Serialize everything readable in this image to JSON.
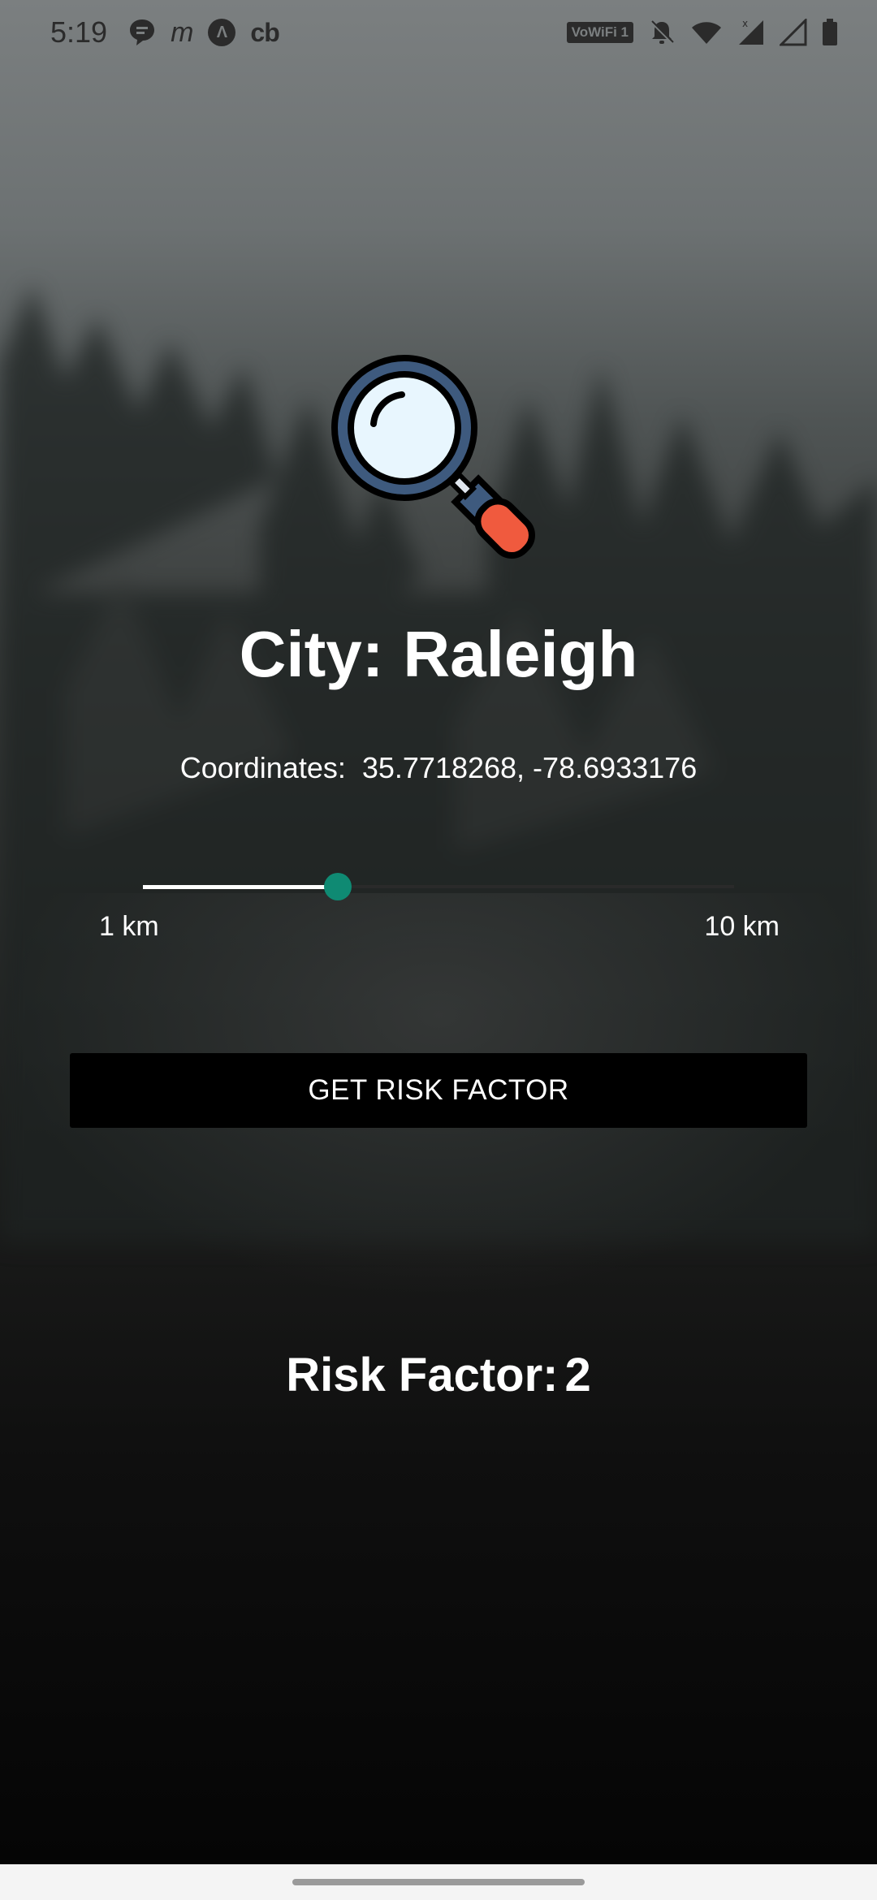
{
  "status_bar": {
    "time": "5:19",
    "left_icons": [
      "chat-icon",
      "mcdonalds-icon",
      "app-circle-icon",
      "cb-icon"
    ],
    "wifi_badge": "VoWiFi 1",
    "right_icons": [
      "mute-icon",
      "wifi-icon",
      "signal-icon",
      "signal-icon",
      "battery-icon"
    ]
  },
  "main": {
    "icon": "magnifier-icon",
    "city_label": "City:",
    "city_name": "Raleigh",
    "coordinates_label": "Coordinates:",
    "coordinates_value": "35.7718268, -78.6933176",
    "slider": {
      "min_label": "1 km",
      "max_label": "10 km",
      "value_fraction": 0.33
    },
    "button_label": "GET RISK FACTOR",
    "risk_label": "Risk Factor:",
    "risk_value": "2"
  },
  "colors": {
    "accent": "#0f8a73",
    "button_bg": "#000000",
    "text": "#ffffff"
  }
}
